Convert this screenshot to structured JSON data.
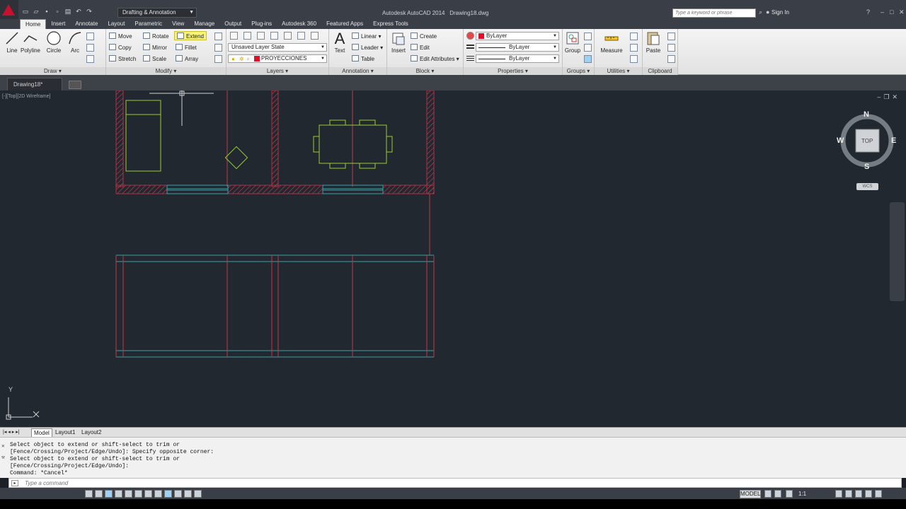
{
  "titlebar": {
    "workspace": "Drafting & Annotation",
    "app_title": "Autodesk AutoCAD 2014",
    "file_name": "Drawing18.dwg",
    "search_placeholder": "Type a keyword or phrase",
    "sign_in": "Sign In"
  },
  "tabs": [
    "Home",
    "Insert",
    "Annotate",
    "Layout",
    "Parametric",
    "View",
    "Manage",
    "Output",
    "Plug-ins",
    "Autodesk 360",
    "Featured Apps",
    "Express Tools"
  ],
  "ribbon": {
    "draw": {
      "title": "Draw",
      "line": "Line",
      "polyline": "Polyline",
      "circle": "Circle",
      "arc": "Arc"
    },
    "modify": {
      "title": "Modify",
      "move": "Move",
      "rotate": "Rotate",
      "extend": "Extend",
      "copy": "Copy",
      "mirror": "Mirror",
      "fillet": "Fillet",
      "stretch": "Stretch",
      "scale": "Scale",
      "array": "Array"
    },
    "layers": {
      "title": "Layers",
      "layer_state": "Unsaved Layer State",
      "current_layer": "PROYECCIONES"
    },
    "annotation": {
      "title": "Annotation",
      "text": "Text",
      "linear": "Linear",
      "leader": "Leader",
      "table": "Table"
    },
    "block": {
      "title": "Block",
      "insert": "Insert",
      "create": "Create",
      "edit": "Edit",
      "edit_attributes": "Edit Attributes"
    },
    "properties": {
      "title": "Properties",
      "color": "ByLayer",
      "linetype": "ByLayer",
      "lineweight": "ByLayer"
    },
    "groups": {
      "title": "Groups",
      "group": "Group"
    },
    "utilities": {
      "title": "Utilities",
      "measure": "Measure"
    },
    "clipboard": {
      "title": "Clipboard",
      "paste": "Paste"
    }
  },
  "document_tab": "Drawing18*",
  "viewport_label": "[-][Top][2D Wireframe]",
  "viewcube": {
    "north": "N",
    "south": "S",
    "east": "E",
    "west": "W",
    "face": "TOP",
    "ucs": "WCS"
  },
  "ucs_icon": {
    "x": "X",
    "y": "Y"
  },
  "layout_tabs": [
    "Model",
    "Layout1",
    "Layout2"
  ],
  "command": {
    "history": [
      "Select object to extend or shift-select to trim or",
      "[Fence/Crossing/Project/Edge/Undo]: Specify opposite corner:",
      "Select object to extend or shift-select to trim or",
      "[Fence/Crossing/Project/Edge/Undo]:",
      "Command: *Cancel*"
    ],
    "placeholder": "Type a command"
  },
  "statusbar": {
    "model": "MODEL",
    "scale": "1:1"
  },
  "colors": {
    "wall": "#c8364a",
    "furniture": "#9acd32",
    "window": "#3aa0a8",
    "cursor": "#d0d0d0",
    "background": "#212830"
  }
}
